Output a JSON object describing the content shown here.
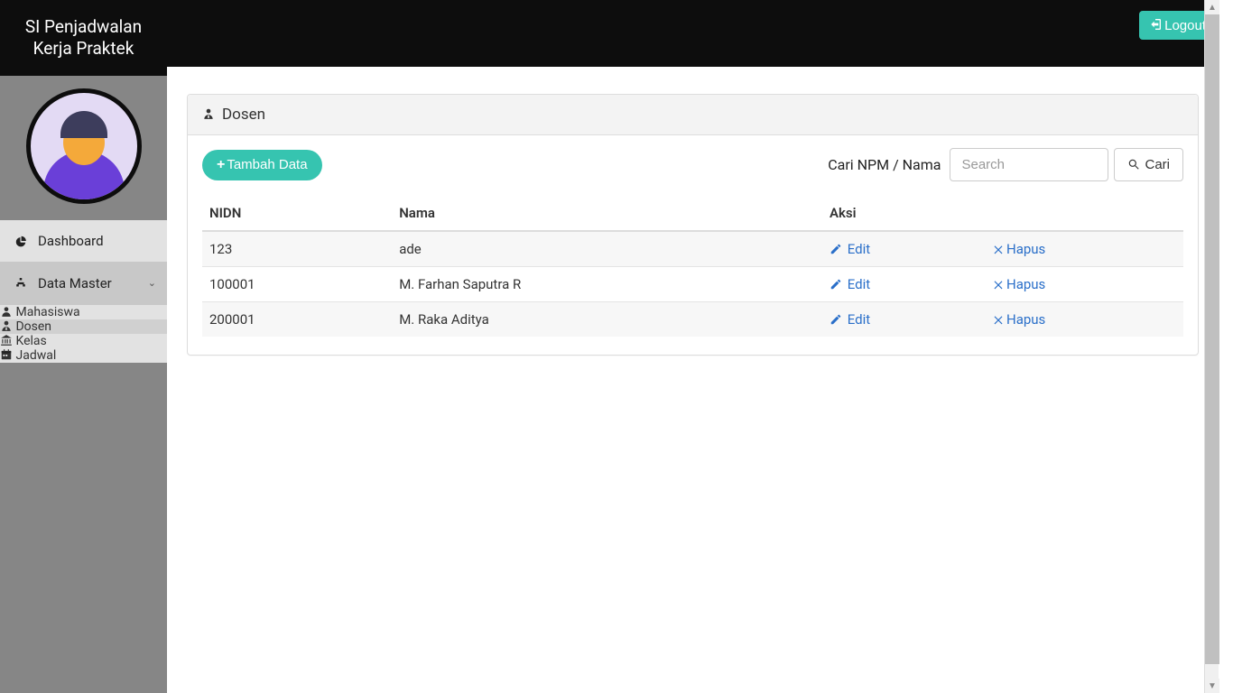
{
  "brand": {
    "line1": "SI Penjadwalan",
    "line2": "Kerja Praktek"
  },
  "logout_label": "Logout",
  "sidebar": {
    "items": [
      {
        "label": "Dashboard",
        "icon": "dashboard-icon"
      },
      {
        "label": "Data Master",
        "icon": "sitemap-icon",
        "expanded": true
      }
    ],
    "sub_items": [
      {
        "label": "Mahasiswa",
        "icon": "user-icon"
      },
      {
        "label": "Dosen",
        "icon": "user-tie-icon",
        "active": true
      },
      {
        "label": "Kelas",
        "icon": "institution-icon"
      },
      {
        "label": "Jadwal",
        "icon": "calendar-icon"
      }
    ]
  },
  "panel": {
    "title": "Dosen"
  },
  "toolbar": {
    "add_label": "Tambah Data",
    "search_label": "Cari NPM / Nama",
    "search_placeholder": "Search",
    "search_button": "Cari"
  },
  "table": {
    "columns": [
      "NIDN",
      "Nama",
      "Aksi"
    ],
    "edit_label": "Edit",
    "delete_label": "Hapus",
    "rows": [
      {
        "nidn": "123",
        "nama": "ade"
      },
      {
        "nidn": "100001",
        "nama": "M. Farhan Saputra R"
      },
      {
        "nidn": "200001",
        "nama": "M. Raka Aditya"
      }
    ]
  },
  "colors": {
    "accent": "#36c4b0",
    "link": "#2a6fc9"
  }
}
